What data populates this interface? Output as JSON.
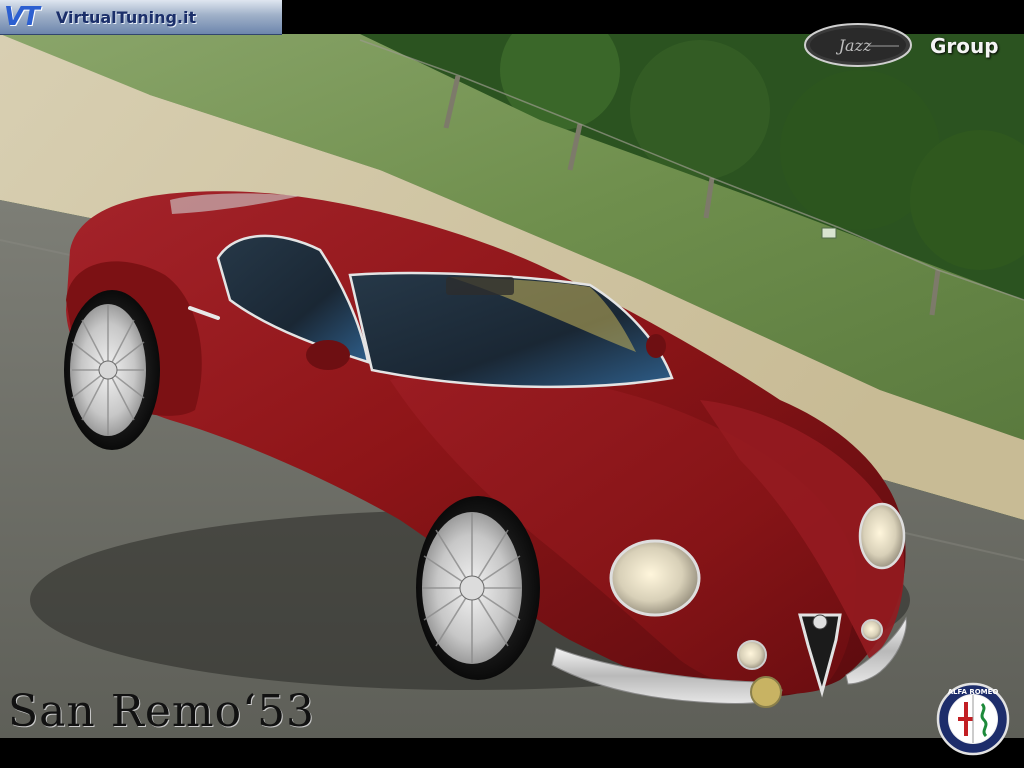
{
  "header": {
    "site_logo_mark": "VT",
    "site_name": "VirtualTuning.it",
    "partner_badge_signature": "Jazz",
    "partner_group_label": "Group"
  },
  "footer": {
    "model_title": "San Remo‘53",
    "brand_badge_text": "ALFA ROMEO"
  },
  "colors": {
    "car_body": "#8e1518",
    "car_shadow": "#4a0709",
    "chrome": "#d9d9d9",
    "foliage": "#2f5a22",
    "road": "#6f7068",
    "sand": "#cfc3a3"
  },
  "icons": [
    "virtualtuning-logo",
    "jazz-group-badge",
    "alfa-romeo-badge"
  ]
}
